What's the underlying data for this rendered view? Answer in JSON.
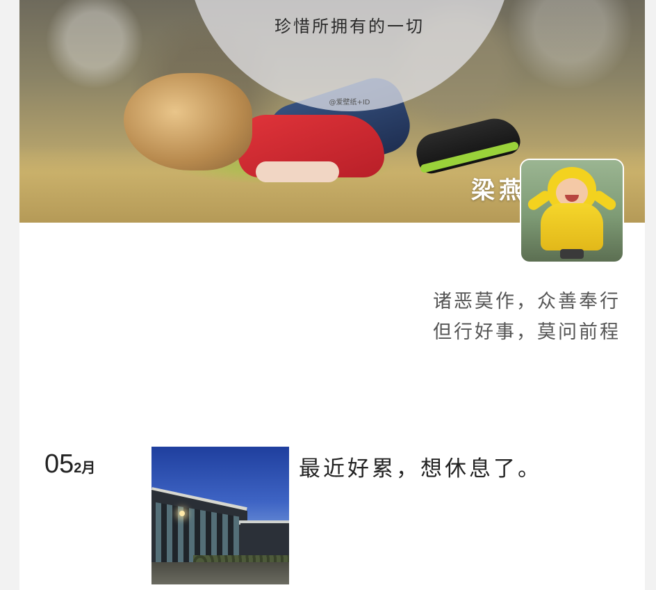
{
  "cover": {
    "title": "珍惜所拥有的一切",
    "watermark": "@爱壁纸+ID"
  },
  "profile": {
    "nickname": "梁燕",
    "signature_line_1": "诸恶莫作，众善奉行",
    "signature_line_2": "但行好事，莫问前程"
  },
  "posts": [
    {
      "day": "05",
      "month": "2月",
      "text": "最近好累，想休息了。"
    }
  ],
  "icons": {
    "avatar": "girl-in-yellow-raincoat-image",
    "cover": "child-lying-on-grass-image",
    "thumbnail": "building-at-dusk-image"
  }
}
